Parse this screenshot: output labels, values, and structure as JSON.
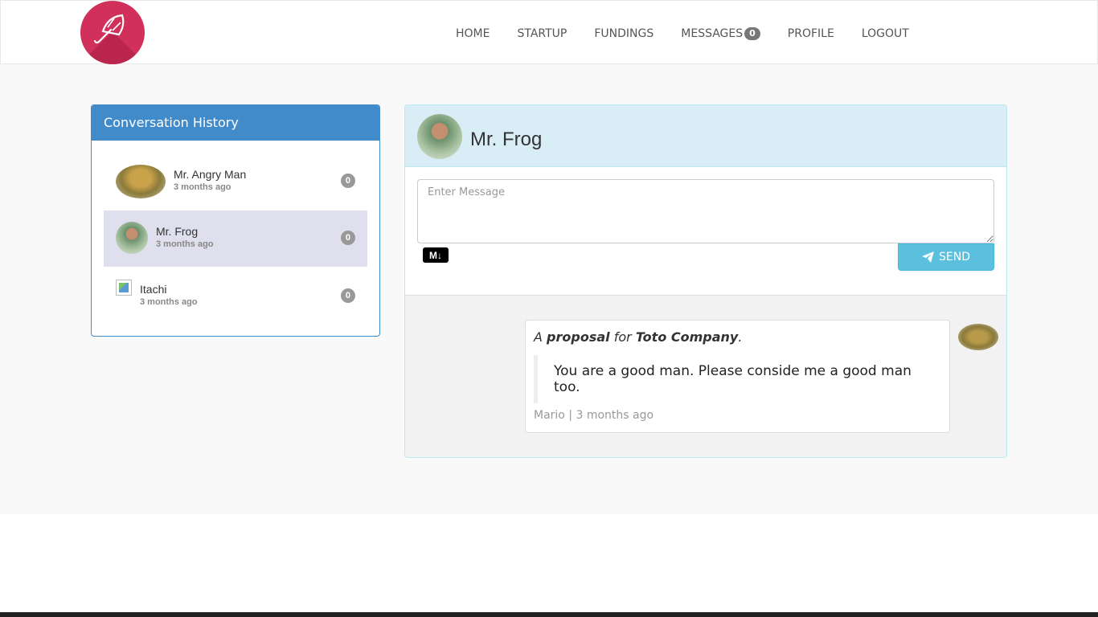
{
  "nav": {
    "items": [
      {
        "label": "HOME"
      },
      {
        "label": "STARTUP"
      },
      {
        "label": "FUNDINGS"
      },
      {
        "label": "MESSAGES",
        "badge": "0"
      },
      {
        "label": "PROFILE"
      },
      {
        "label": "LOGOUT"
      }
    ]
  },
  "history": {
    "title": "Conversation History",
    "conversations": [
      {
        "name": "Mr. Angry Man",
        "time": "3 months ago",
        "unread": "0"
      },
      {
        "name": "Mr. Frog",
        "time": "3 months ago",
        "unread": "0",
        "active": true
      },
      {
        "name": "Itachi",
        "time": "3 months ago",
        "unread": "0"
      }
    ]
  },
  "chat": {
    "title": "Mr. Frog",
    "input_placeholder": "Enter Message",
    "send_label": "SEND",
    "markdown_icon": "M↓",
    "message": {
      "lead_a": "A",
      "lead_b": "proposal",
      "lead_c": "for",
      "lead_d": "Toto Company",
      "lead_e": ".",
      "quote": "You are a good man. Please conside me a good man too.",
      "meta": "Mario | 3 months ago"
    }
  },
  "colors": {
    "primary": "#428bca",
    "info": "#5bc0de",
    "brand": "#d0305a",
    "active_row": "#dfdfed"
  }
}
